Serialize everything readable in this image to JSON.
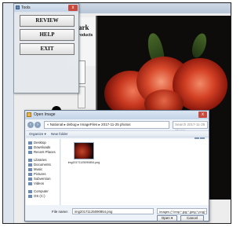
{
  "tools_window": {
    "title": "Tools",
    "close": "x",
    "buttons": [
      "REVIEW",
      "HELP",
      "EXIT"
    ]
  },
  "background_app": {
    "title_fragment": "ark",
    "subtitle_fragment": "roducts"
  },
  "open_dialog": {
    "title": "Open Image",
    "close": "x",
    "address": "« National ▸ debug ▸ ImageFiles ▸ 2017-11-25 photos",
    "search_placeholder": "Search 2017-11-25 photos",
    "toolbar": {
      "organize": "Organize ▾",
      "new_folder": "New folder"
    },
    "nav_pane": {
      "items": [
        "Desktop",
        "Downloads",
        "Recent Places",
        "Libraries",
        "Documents",
        "Music",
        "Pictures",
        "Subversion",
        "Videos",
        "Computer",
        "OS (C:)"
      ]
    },
    "file": {
      "name": "img20171125090854.png"
    },
    "file_name_label": "File name:",
    "file_name_value": "img20171125090854.png",
    "file_type": "Images (*.bmp;*.jpg;*.jpeg;*.png) ▾",
    "buttons": {
      "open": "Open ▾",
      "cancel": "Cancel"
    }
  }
}
